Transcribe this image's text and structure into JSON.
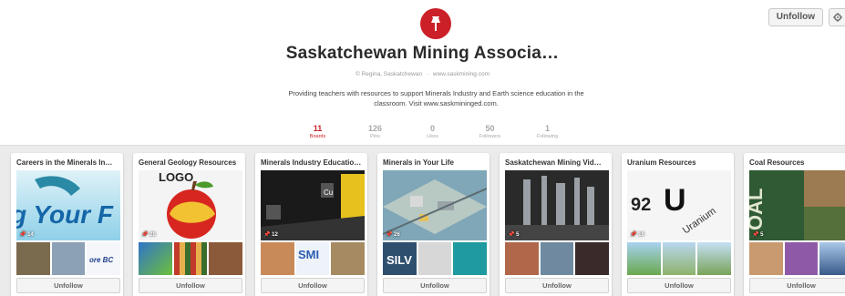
{
  "header": {
    "unfollow_label": "Unfollow",
    "title": "Saskatchewan Mining Associa…",
    "location": "© Regina, Saskatchewan",
    "separator": "·",
    "website": "www.saskmining.com",
    "description": "Providing teachers with resources to support Minerals Industry and Earth science education in the classroom. Visit www.saskmininged.com."
  },
  "stats": [
    {
      "value": "11",
      "label": "Boards",
      "active": true
    },
    {
      "value": "126",
      "label": "Pins"
    },
    {
      "value": "0",
      "label": "Likes"
    },
    {
      "value": "50",
      "label": "Followers"
    },
    {
      "value": "1",
      "label": "Following"
    }
  ],
  "boards": [
    {
      "title": "Careers in the Minerals In…",
      "pins": "14",
      "button": "Unfollow",
      "cover_text": "g Your F"
    },
    {
      "title": "General Geology Resources",
      "pins": "28",
      "button": "Unfollow",
      "cover_text": "LOGO"
    },
    {
      "title": "Minerals Industry Educatio…",
      "pins": "12",
      "button": "Unfollow",
      "cover_text": "Cu"
    },
    {
      "title": "Minerals in Your Life",
      "pins": "26",
      "button": "Unfollow",
      "cover_text": ""
    },
    {
      "title": "Saskatchewan Mining Vid…",
      "pins": "5",
      "button": "Unfollow",
      "cover_text": ""
    },
    {
      "title": "Uranium Resources",
      "pins": "16",
      "button": "Unfollow",
      "cover_text": "U"
    },
    {
      "title": "Coal Resources",
      "pins": "5",
      "button": "Unfollow",
      "cover_text": "OAL"
    }
  ],
  "colors": {
    "accent": "#cb2027",
    "background": "#ebebeb"
  }
}
